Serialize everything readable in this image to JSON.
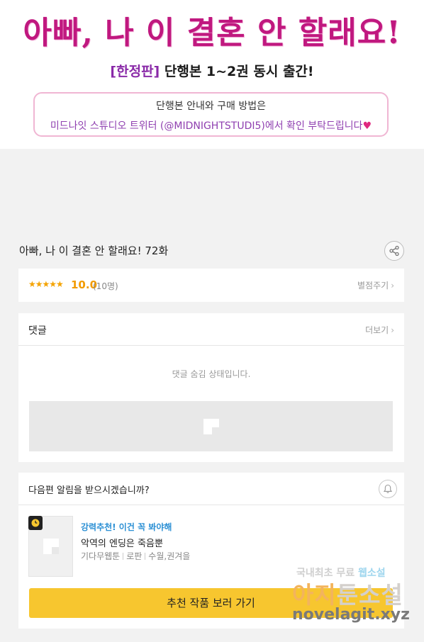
{
  "banner": {
    "title": "아빠, 나 이 결혼 안 할래요!",
    "subtitle_tag": "[한정판]",
    "subtitle_rest": "단행본 1~2권 동시 출간!",
    "box_line1": "단행본 안내와 구매 방법은",
    "box_line2": "미드나잇 스튜디오 트위터 (@MIDNIGHTSTUDI5)에서 확인 부탁드립니다",
    "box_heart": "♥"
  },
  "episode": {
    "title": "아빠, 나 이 결혼 안 할래요! 72화"
  },
  "rating": {
    "stars": "★★★★★",
    "score": "10.0",
    "count": "(10명)",
    "rate_link": "별점주기",
    "chevron": "›"
  },
  "comments": {
    "label": "댓글",
    "more": "더보기",
    "chevron": "›",
    "hidden_message": "댓글 숨김 상태입니다."
  },
  "notify": {
    "question": "다음편 알림을 받으시겠습니까?",
    "recommend_tag": "강력추천! 이건 꼭 봐야해",
    "recommend_title": "악역의 엔딩은 죽음뿐",
    "meta": [
      "기다무웹툰",
      "로판",
      "수월,권겨을"
    ],
    "cta_label": "추천 작품 보러 가기"
  },
  "watermark": {
    "line1_a": "국내최초 무료 ",
    "line1_b": "웹소설",
    "line2_a": "아지",
    "line2_b": "툰소설",
    "line3": "novelagit.xyz"
  },
  "colors": {
    "accent_yellow": "#f7c62f",
    "rating_orange": "#f29b00",
    "recommend_blue": "#2a8fd4",
    "banner_magenta": "#c0187f"
  }
}
